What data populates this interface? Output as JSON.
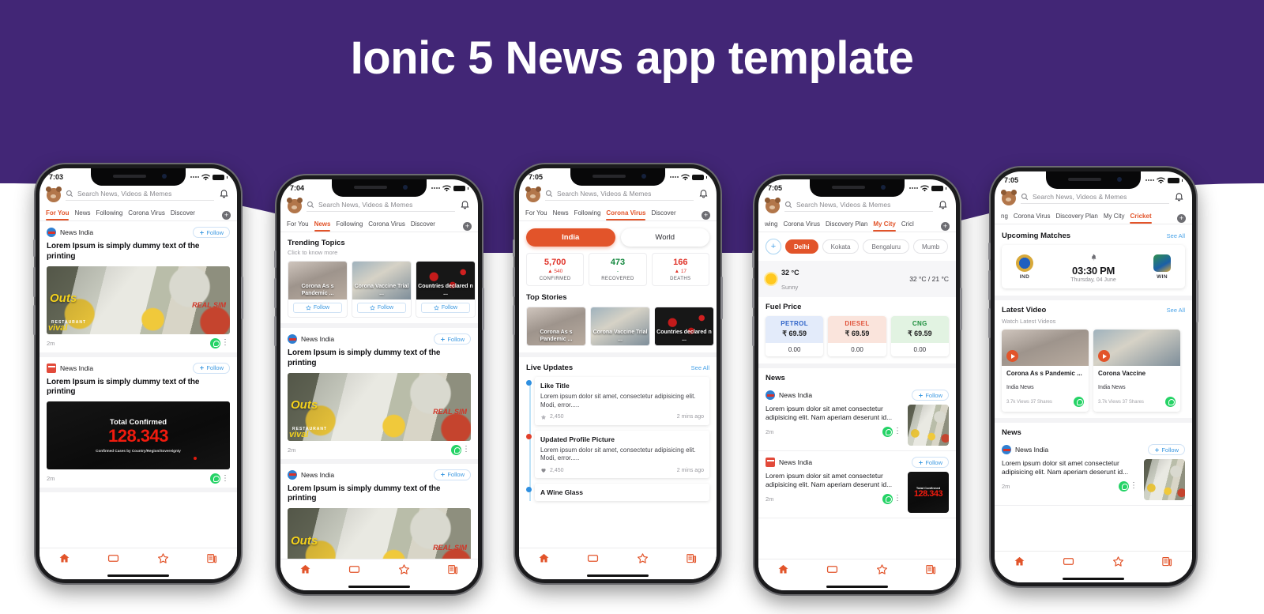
{
  "page": {
    "title": "Ionic 5 News app template",
    "brand_purple": "#422676",
    "accent_orange": "#e2542a",
    "link_blue": "#4aa3e8"
  },
  "common": {
    "search_placeholder": "Search News, Videos & Memes",
    "follow_label": "Follow",
    "see_all": "See All",
    "source_name": "News India",
    "time_ago": "2m",
    "bottom_nav": [
      {
        "name": "home-icon",
        "label": "Home"
      },
      {
        "name": "tv-icon",
        "label": "Live TV"
      },
      {
        "name": "star-icon",
        "label": "Favourites"
      },
      {
        "name": "newspaper-icon",
        "label": "News"
      }
    ]
  },
  "phones": [
    {
      "id": "phone-for-you",
      "status_time": "7:03",
      "tabs": [
        {
          "label": "For You",
          "active": true
        },
        {
          "label": "News",
          "active": false
        },
        {
          "label": "Following",
          "active": false
        },
        {
          "label": "Corona Virus",
          "active": false
        },
        {
          "label": "Discover",
          "active": false
        }
      ],
      "feed": [
        {
          "source": "News India",
          "title": "Lorem Ipsum is simply dummy text of the printing",
          "time": "2m",
          "image_kind": "magazines",
          "image_labels": {
            "l1": "Outs",
            "l2": "REAL SIM",
            "l3": "RESTAURANT",
            "l4": "vival"
          }
        },
        {
          "source": "News India",
          "title": "Lorem Ipsum is simply dummy text of the printing",
          "time": "2m",
          "image_kind": "covid-counter",
          "covid": {
            "heading": "Total Confirmed",
            "number": "128.343",
            "caption": "Confirmed Cases by Country/Region/Sovereignty"
          }
        }
      ]
    },
    {
      "id": "phone-news",
      "status_time": "7:04",
      "tabs": [
        {
          "label": "For You",
          "active": false
        },
        {
          "label": "News",
          "active": true
        },
        {
          "label": "Following",
          "active": false
        },
        {
          "label": "Corona Virus",
          "active": false
        },
        {
          "label": "Discover",
          "active": false
        }
      ],
      "trending": {
        "title": "Trending Topics",
        "subtitle": "Click to know more",
        "cards": [
          {
            "caption": "Corona As s Pandemic ...",
            "follow": "Follow",
            "image_kind": "hands"
          },
          {
            "caption": "Corona Vaccine Trial ...",
            "follow": "Follow",
            "image_kind": "lab"
          },
          {
            "caption": "Countries declared n ...",
            "follow": "Follow",
            "image_kind": "map"
          }
        ]
      },
      "feed": [
        {
          "source": "News India",
          "title": "Lorem Ipsum is simply dummy text of the printing",
          "time": "2m",
          "image_kind": "magazines"
        },
        {
          "source": "News India",
          "title": "Lorem Ipsum is simply dummy text of the printing",
          "time": "2m",
          "image_kind": "magazines"
        }
      ]
    },
    {
      "id": "phone-corona",
      "status_time": "7:05",
      "tabs": [
        {
          "label": "For You",
          "active": false
        },
        {
          "label": "News",
          "active": false
        },
        {
          "label": "Following",
          "active": false
        },
        {
          "label": "Corona Virus",
          "active": true
        },
        {
          "label": "Discover",
          "active": false
        }
      ],
      "segment": [
        {
          "label": "India",
          "active": true
        },
        {
          "label": "World",
          "active": false
        }
      ],
      "stats": [
        {
          "value": "5,700",
          "delta": "540",
          "delta_dir": "up",
          "label": "CONFIRMED",
          "color": "red"
        },
        {
          "value": "473",
          "delta": "-",
          "delta_dir": "none",
          "label": "RECOVERED",
          "color": "green"
        },
        {
          "value": "166",
          "delta": "17",
          "delta_dir": "up",
          "label": "DEATHS",
          "color": "red"
        }
      ],
      "top_stories": {
        "title": "Top Stories",
        "cards": [
          {
            "caption": "Corona As s Pandemic ...",
            "image_kind": "hands"
          },
          {
            "caption": "Corona Vaccine Trial ...",
            "image_kind": "lab"
          },
          {
            "caption": "Countries declared n ...",
            "image_kind": "map"
          }
        ]
      },
      "live_updates": {
        "title": "Live Updates",
        "see_all": "See All",
        "items": [
          {
            "heading": "Like Title",
            "body": "Lorem ipsum dolor sit amet, consectetur adipisicing elit. Modi, error.....",
            "count": "2,450",
            "icon": "star-icon",
            "time": "2 mins ago",
            "dot_color": "#2f8fe0"
          },
          {
            "heading": "Updated Profile Picture",
            "body": "Lorem ipsum dolor sit amet, consectetur adipisicing elit. Modi, error.....",
            "count": "2,450",
            "icon": "heart-icon",
            "time": "2 mins ago",
            "dot_color": "#e2402a"
          },
          {
            "heading": "A Wine Glass",
            "body": "",
            "count": "",
            "icon": "",
            "time": "",
            "dot_color": "#2f8fe0"
          }
        ]
      }
    },
    {
      "id": "phone-my-city",
      "status_time": "7:05",
      "tabs": [
        {
          "label": "wing",
          "active": false
        },
        {
          "label": "Corona Virus",
          "active": false
        },
        {
          "label": "Discovery Plan",
          "active": false
        },
        {
          "label": "My City",
          "active": true
        },
        {
          "label": "Cricl",
          "active": false
        }
      ],
      "cities": [
        {
          "label": "+",
          "active": false,
          "is_add": true
        },
        {
          "label": "Delhi",
          "active": true
        },
        {
          "label": "Kokata",
          "active": false
        },
        {
          "label": "Bengaluru",
          "active": false
        },
        {
          "label": "Mumb",
          "active": false
        }
      ],
      "weather": {
        "temp": "32 °C",
        "condition": "Sunny",
        "range": "32 °C / 21 °C"
      },
      "fuel": {
        "title": "Fuel Price",
        "items": [
          {
            "name": "PETROL",
            "price": "₹ 69.59",
            "change": "0.00"
          },
          {
            "name": "DIESEL",
            "price": "₹ 69.59",
            "change": "0.00"
          },
          {
            "name": "CNG",
            "price": "₹ 69.59",
            "change": "0.00"
          }
        ]
      },
      "news": {
        "title": "News",
        "items": [
          {
            "source": "News India",
            "text": "Lorem ipsum dolor sit amet consectetur adipisicing elit. Nam aperiam deserunt id...",
            "time": "2m",
            "image_kind": "magazines"
          },
          {
            "source": "News India",
            "text": "Lorem ipsum dolor sit amet consectetur adipisicing elit. Nam aperiam deserunt id...",
            "time": "2m",
            "image_kind": "covid-counter"
          }
        ]
      }
    },
    {
      "id": "phone-cricket",
      "status_time": "7:05",
      "tabs": [
        {
          "label": "ng",
          "active": false
        },
        {
          "label": "Corona Virus",
          "active": false
        },
        {
          "label": "Discovery Plan",
          "active": false
        },
        {
          "label": "My City",
          "active": false
        },
        {
          "label": "Cricket",
          "active": true
        }
      ],
      "upcoming": {
        "title": "Upcoming Matches",
        "see_all": "See All",
        "match": {
          "home_team": "IND",
          "away_team": "WIN",
          "time": "03:30 PM",
          "date": "Thursday, 04 June"
        }
      },
      "latest_video": {
        "title": "Latest Video",
        "see_all": "See All",
        "subtitle": "Watch Latest Videos",
        "videos": [
          {
            "title": "Corona As s Pandemic ...",
            "source": "India News",
            "stats": "3.7k Views 37 Shares",
            "image_kind": "hands"
          },
          {
            "title": "Corona Vaccine",
            "source": "India News",
            "stats": "3.7k Views 37 Shares",
            "image_kind": "lab"
          }
        ]
      },
      "news": {
        "title": "News",
        "items": [
          {
            "source": "News India",
            "text": "Lorem ipsum dolor sit amet consectetur adipisicing elit. Nam aperiam deserunt id...",
            "time": "2m",
            "image_kind": "magazines"
          }
        ]
      }
    }
  ]
}
